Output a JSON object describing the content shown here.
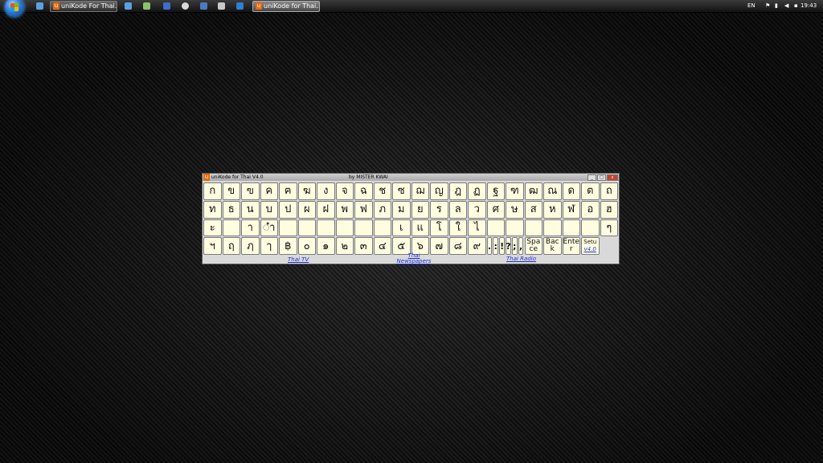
{
  "taskbar": {
    "tasks": [
      {
        "label": "uniKode For Thai..."
      },
      {
        "label": "uniKode for Thai..."
      }
    ],
    "tray": {
      "language": "EN",
      "time": "19:43"
    }
  },
  "window": {
    "title": "uniKode for Thai V4.0",
    "byline": "by MISTER KWAI",
    "controls": {
      "minimize": "_",
      "maximize": "□",
      "close": "x"
    }
  },
  "keyboard": {
    "row1": [
      "ก",
      "ข",
      "ฃ",
      "ค",
      "ฅ",
      "ฆ",
      "ง",
      "จ",
      "ฉ",
      "ช",
      "ซ",
      "ฌ",
      "ญ",
      "ฎ",
      "ฏ",
      "ฐ",
      "ฑ",
      "ฒ",
      "ณ",
      "ด",
      "ต",
      "ถ"
    ],
    "row2": [
      "ท",
      "ธ",
      "น",
      "บ",
      "ป",
      "ผ",
      "ฝ",
      "พ",
      "ฟ",
      "ภ",
      "ม",
      "ย",
      "ร",
      "ล",
      "ว",
      "ศ",
      "ษ",
      "ส",
      "ห",
      "ฬ",
      "อ",
      "ฮ"
    ],
    "row3": [
      "ะ",
      "",
      "า",
      "◌ํา",
      "",
      "",
      "",
      "",
      "",
      "",
      "เ",
      "แ",
      "โ",
      "ใ",
      "ไ",
      "",
      "",
      "",
      "",
      "",
      "",
      "ๆ"
    ],
    "row4": [
      "ฯ",
      "ฤ",
      "ฦ",
      "ๅ",
      "฿",
      "๐",
      "๑",
      "๒",
      "๓",
      "๔",
      "๕",
      "๖",
      "๗",
      "๘",
      "๙"
    ],
    "punct": [
      ".",
      ":",
      "!",
      "?",
      ";",
      ","
    ],
    "space": "Space",
    "back": "Back",
    "enter": "Enter",
    "setup": "Setu",
    "version": "v4.0"
  },
  "links": {
    "tv": "Thai TV",
    "newspapers": "Thai Newspapers",
    "radio": "Thai Radio"
  }
}
